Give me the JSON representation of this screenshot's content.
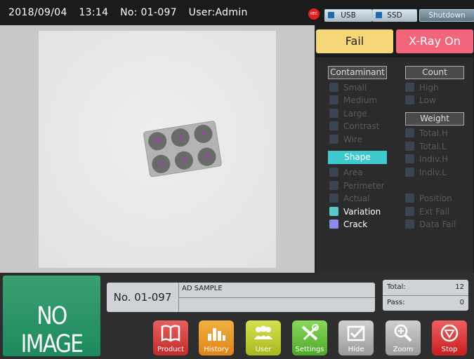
{
  "topbar": {
    "date": "2018/09/04",
    "time": "13:14",
    "number": "No: 01-097",
    "user": "User:Admin",
    "rec_label": "REC",
    "usb_label": "USB",
    "ssd_label": "SSD",
    "shutdown_label": "Shutdown"
  },
  "status": {
    "result": "Fail",
    "xray": "X-Ray On",
    "fail_color": "#f5d77a",
    "xray_color": "#f2657a"
  },
  "filters": {
    "contaminant_header": "Contaminant",
    "contaminant_items": [
      "Small",
      "Medium",
      "Large",
      "Contrast",
      "Wire"
    ],
    "shape_header": "Shape",
    "shape_items": [
      "Area",
      "Perimeter",
      "Actual",
      "Variation",
      "Crack"
    ],
    "count_header": "Count",
    "count_items": [
      "High",
      "Low"
    ],
    "weight_header": "Weight",
    "weight_items": [
      "Total.H",
      "Total.L",
      "Indiv.H",
      "Indiv.L"
    ],
    "other_items": [
      "Position",
      "Ext Fail",
      "Data Fail"
    ]
  },
  "thumbnail": {
    "text": "NO IMAGE"
  },
  "product": {
    "number": "No. 01-097",
    "name": "AD SAMPLE"
  },
  "counts": {
    "total_label": "Total:",
    "total_value": "12",
    "pass_label": "Pass:",
    "pass_value": "0"
  },
  "toolbar": {
    "product": "Product",
    "history": "History",
    "user": "User",
    "settings": "Settings",
    "hide": "Hide",
    "zoom": "Zoom",
    "stop": "Stop"
  }
}
